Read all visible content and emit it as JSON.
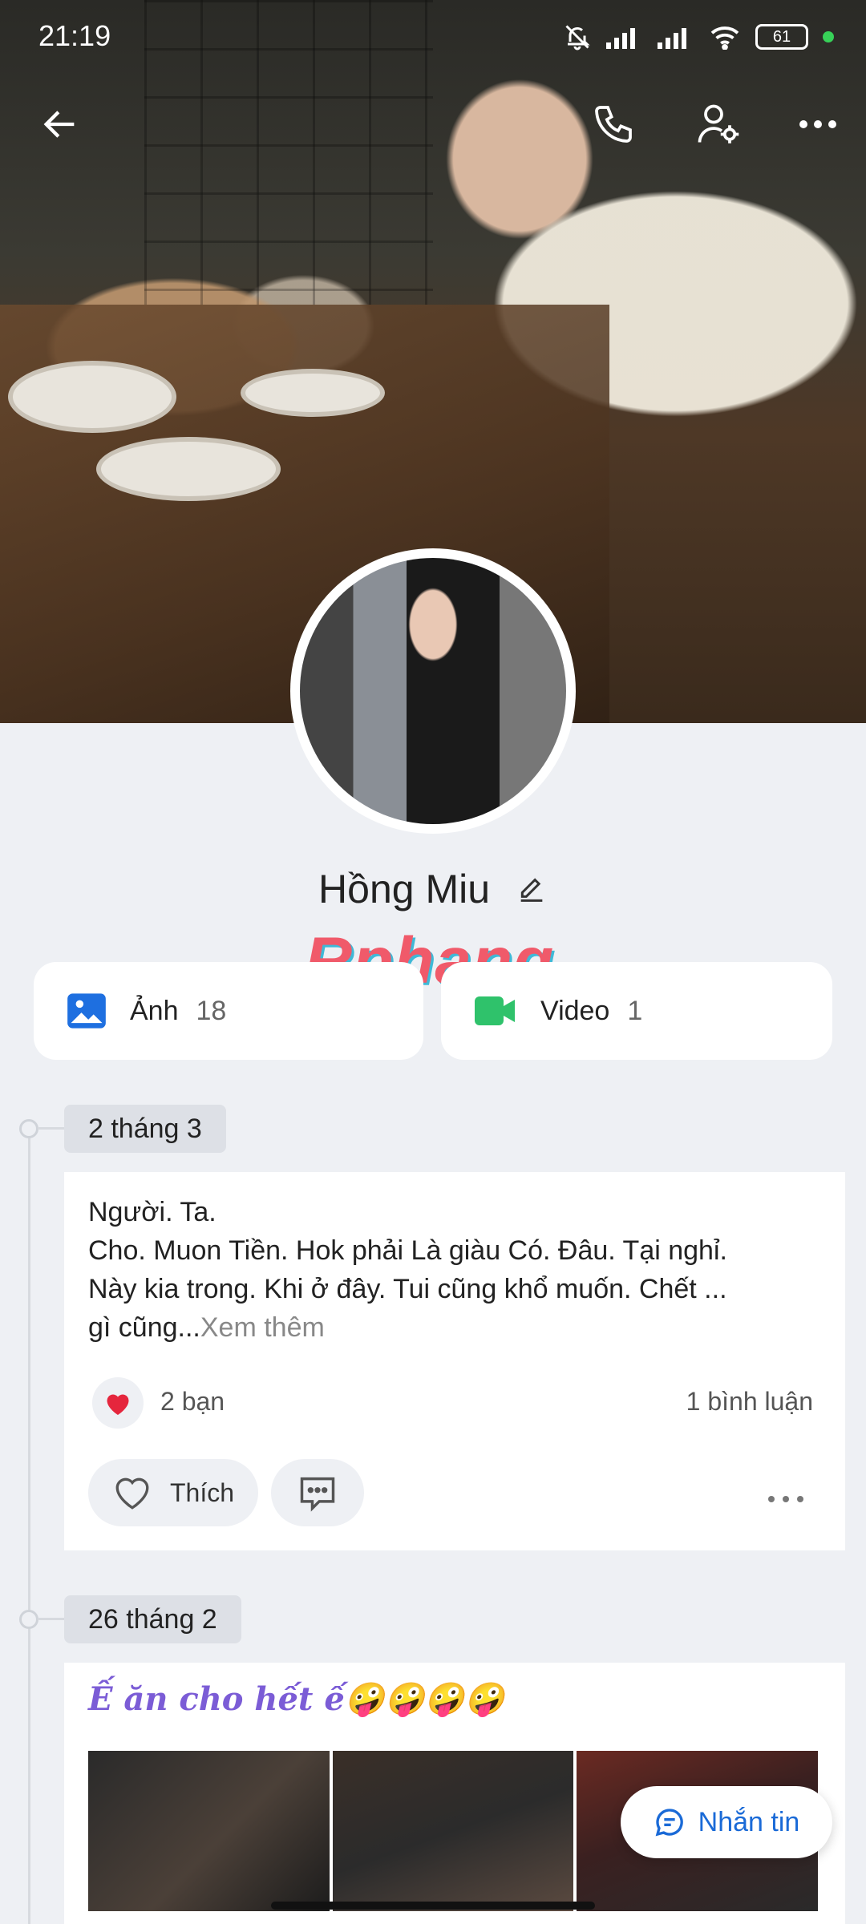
{
  "status_bar": {
    "time": "21:19",
    "battery": "61"
  },
  "profile": {
    "name": "Hồng Miu"
  },
  "media": {
    "photos": {
      "label": "Ảnh",
      "count": "18"
    },
    "videos": {
      "label": "Video",
      "count": "1"
    }
  },
  "watermark": "Rphang",
  "posts": [
    {
      "date": "2 tháng 3",
      "line1": "Người. Ta.",
      "line2": "Cho. Muon Tiền. Hok phải Là giàu Có. Đâu. Tại nghỉ.",
      "line3": "Này kia trong. Khi ở đây. Tui cũng khổ muốn. Chết ...",
      "line4": "gì cũng...",
      "see_more": "Xem thêm",
      "reactions": "2 bạn",
      "comments": "1 bình luận",
      "like_label": "Thích"
    },
    {
      "date": "26 tháng 2",
      "title": "Ế ăn cho hết ế🤪🤪🤪🤪"
    }
  ],
  "message_button": "Nhắn tin",
  "colors": {
    "accent": "#1a6ad7",
    "photo_icon": "#1e6fe0",
    "video_icon": "#2fc26b",
    "heart": "#e5263d"
  }
}
